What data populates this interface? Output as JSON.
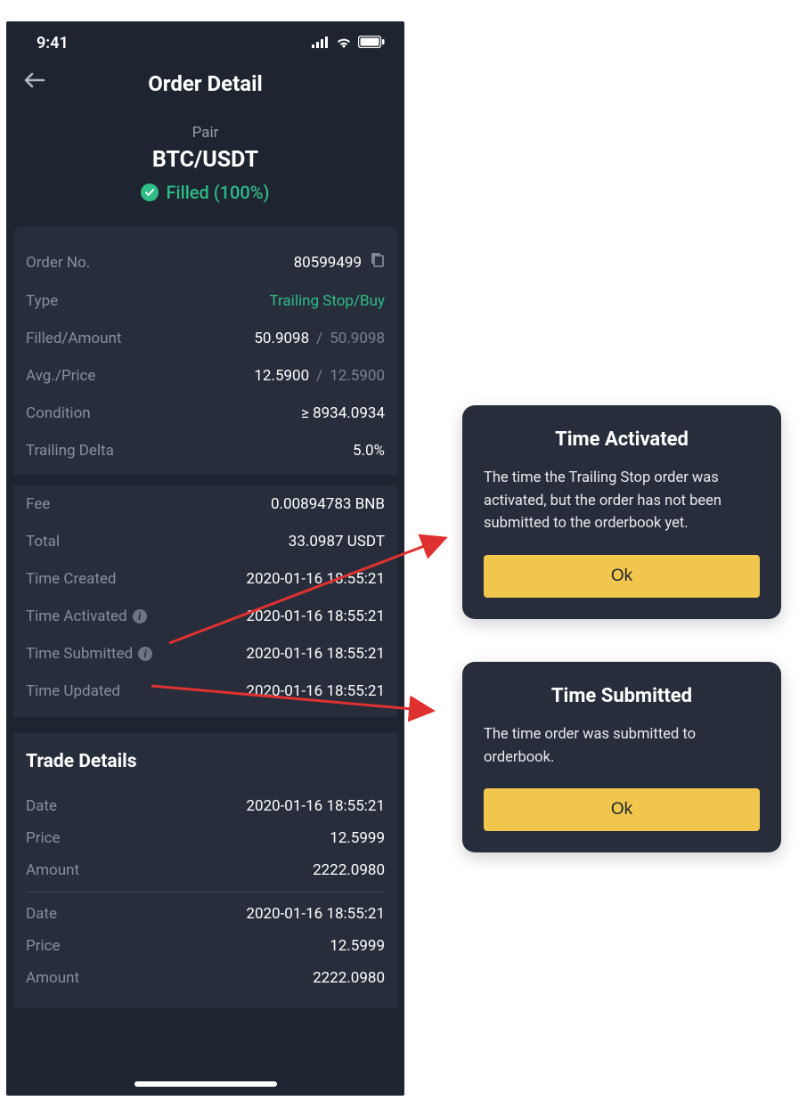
{
  "statusbar": {
    "time": "9:41"
  },
  "nav": {
    "title": "Order Detail"
  },
  "header": {
    "pair_label": "Pair",
    "pair": "BTC/USDT",
    "status": "Filled (100%)"
  },
  "details": {
    "order_no_label": "Order No.",
    "order_no": "80599499",
    "type_label": "Type",
    "type": "Trailing Stop/Buy",
    "filled_amount_label": "Filled/Amount",
    "filled": "50.9098",
    "amount": "50.9098",
    "avg_price_label": "Avg./Price",
    "avg": "12.5900",
    "price": "12.5900",
    "condition_label": "Condition",
    "condition": "≥ 8934.0934",
    "trailing_delta_label": "Trailing Delta",
    "trailing_delta": "5.0%",
    "fee_label": "Fee",
    "fee": "0.00894783 BNB",
    "total_label": "Total",
    "total": "33.0987 USDT",
    "time_created_label": "Time Created",
    "time_created": "2020-01-16 18:55:21",
    "time_activated_label": "Time Activated",
    "time_activated": "2020-01-16 18:55:21",
    "time_submitted_label": "Time Submitted",
    "time_submitted": "2020-01-16 18:55:21",
    "time_updated_label": "Time Updated",
    "time_updated": "2020-01-16 18:55:21"
  },
  "trade": {
    "title": "Trade Details",
    "rows": [
      {
        "date_label": "Date",
        "date": "2020-01-16 18:55:21",
        "price_label": "Price",
        "price": "12.5999",
        "amount_label": "Amount",
        "amount": "2222.0980"
      },
      {
        "date_label": "Date",
        "date": "2020-01-16 18:55:21",
        "price_label": "Price",
        "price": "12.5999",
        "amount_label": "Amount",
        "amount": "2222.0980"
      }
    ]
  },
  "modals": {
    "activated": {
      "title": "Time Activated",
      "body": "The time the Trailing Stop order was activated, but the order has not been submitted to the orderbook yet.",
      "ok": "Ok"
    },
    "submitted": {
      "title": "Time Submitted",
      "body": "The time order was submitted to orderbook.",
      "ok": "Ok"
    }
  }
}
